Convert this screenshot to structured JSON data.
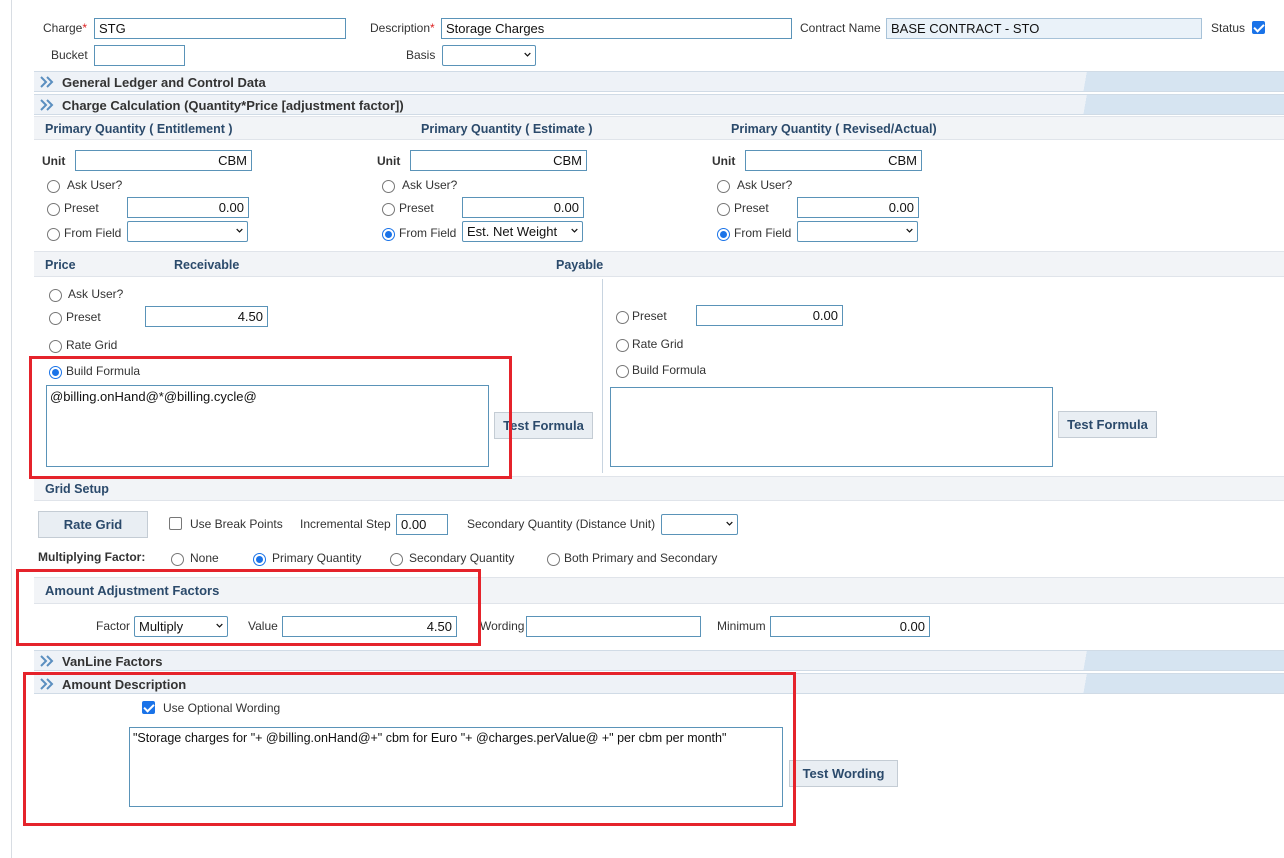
{
  "header": {
    "charge_label": "Charge",
    "charge_value": "STG",
    "description_label": "Description",
    "description_value": "Storage Charges",
    "contract_label": "Contract Name",
    "contract_value": "BASE CONTRACT - STO",
    "status_label": "Status",
    "status_checked": true,
    "bucket_label": "Bucket",
    "bucket_value": "",
    "basis_label": "Basis",
    "basis_value": "",
    "required_mark": "*"
  },
  "sections": {
    "general_ledger": "General Ledger and Control Data",
    "charge_calc": "Charge Calculation (Quantity*Price [adjustment factor])",
    "vanline": "VanLine Factors",
    "amount_description": "Amount Description"
  },
  "quantities": [
    {
      "title": "Primary Quantity  ( Entitlement )",
      "unit": "CBM",
      "preset": "0.00",
      "from_field": "",
      "selected": "none"
    },
    {
      "title": "Primary Quantity  ( Estimate )",
      "unit": "CBM",
      "preset": "0.00",
      "from_field": "Est. Net Weight",
      "selected": "from_field"
    },
    {
      "title": "Primary Quantity  ( Revised/Actual)",
      "unit": "CBM",
      "preset": "0.00",
      "from_field": "",
      "selected": "from_field"
    }
  ],
  "qty_labels": {
    "unit": "Unit",
    "ask": "Ask User?",
    "preset": "Preset",
    "from_field": "From Field"
  },
  "price": {
    "price_label": "Price",
    "receivable_label": "Receivable",
    "payable_label": "Payable",
    "ask": "Ask User?",
    "preset": "Preset",
    "rate_grid": "Rate Grid",
    "build_formula": "Build Formula",
    "receivable_preset": "4.50",
    "receivable_formula": "@billing.onHand@*@billing.cycle@",
    "payable_preset": "0.00",
    "payable_formula": "",
    "test_formula": "Test Formula"
  },
  "grid_setup": {
    "title": "Grid Setup",
    "rate_grid_button": "Rate Grid",
    "use_break_points": "Use Break Points",
    "incremental_step_label": "Incremental Step",
    "incremental_step_value": "0.00",
    "secondary_qty_label": "Secondary Quantity (Distance Unit)",
    "secondary_qty_value": "",
    "multiplying_label": "Multiplying Factor:",
    "mult_options": [
      "None",
      "Primary Quantity",
      "Secondary Quantity",
      "Both Primary and Secondary"
    ],
    "mult_selected": "Primary Quantity"
  },
  "adjustment": {
    "title": "Amount Adjustment Factors",
    "factor_label": "Factor",
    "factor_value": "Multiply",
    "value_label": "Value",
    "value": "4.50",
    "wording_label": "Wording",
    "wording_value": "",
    "minimum_label": "Minimum",
    "minimum_value": "0.00"
  },
  "description": {
    "use_optional_label": "Use Optional Wording",
    "use_optional_checked": true,
    "text": "\"Storage charges for \"+ @billing.onHand@+\" cbm for Euro \"+ @charges.perValue@ +\" per cbm per month\"",
    "test_wording": "Test Wording"
  },
  "colors": {
    "accent": "#1a73e8",
    "highlight": "#e5232b",
    "header_text": "#2b4a6b"
  }
}
